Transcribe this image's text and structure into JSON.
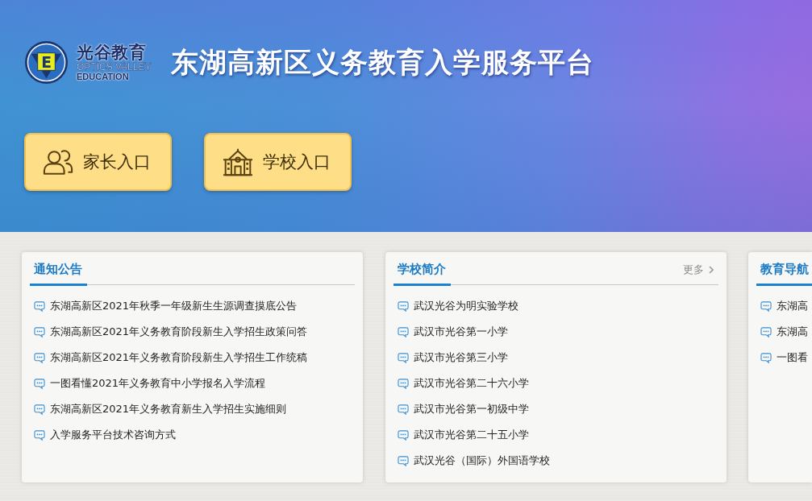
{
  "header": {
    "logo": {
      "mark": "E",
      "name": "光谷教育",
      "name_en": "OPTICS VALLEY",
      "name_en_2": "EDUCATION"
    },
    "title": "东湖高新区义务教育入学服务平台",
    "entries": [
      {
        "label": "家长入口",
        "kind": "parents"
      },
      {
        "label": "学校入口",
        "kind": "school"
      }
    ]
  },
  "panels": [
    {
      "title": "通知公告",
      "items": [
        "东湖高新区2021年秋季一年级新生生源调查摸底公告",
        "东湖高新区2021年义务教育阶段新生入学招生政策问答",
        "东湖高新区2021年义务教育阶段新生入学招生工作统稿",
        "一图看懂2021年义务教育中小学报名入学流程",
        "东湖高新区2021年义务教育新生入学招生实施细则",
        "入学服务平台技术咨询方式"
      ]
    },
    {
      "title": "学校简介",
      "more": "更多",
      "items": [
        "武汉光谷为明实验学校",
        "武汉市光谷第一小学",
        "武汉市光谷第三小学",
        "武汉市光谷第二十六小学",
        "武汉市光谷第一初级中学",
        "武汉市光谷第二十五小学",
        "武汉光谷（国际）外国语学校"
      ]
    },
    {
      "title": "教育导航",
      "items": [
        "东湖高",
        "东湖高",
        "一图看"
      ]
    }
  ]
}
